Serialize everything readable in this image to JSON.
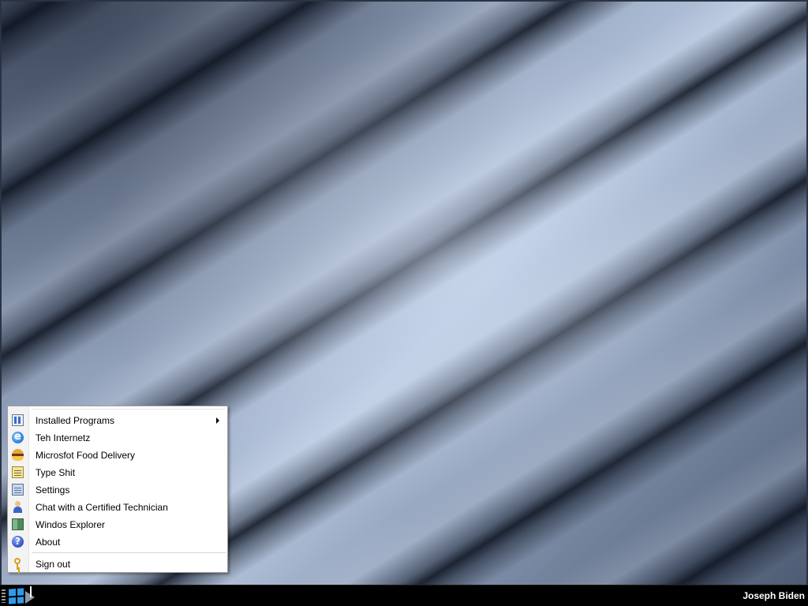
{
  "start_menu": {
    "items": [
      {
        "label": "Installed Programs",
        "icon": "installed-programs-icon",
        "has_submenu": true
      },
      {
        "label": "Teh Internetz",
        "icon": "internet-explorer-icon",
        "has_submenu": false
      },
      {
        "label": "Microsfot Food Delivery",
        "icon": "burger-icon",
        "has_submenu": false
      },
      {
        "label": "Type Shit",
        "icon": "notepad-icon",
        "has_submenu": false
      },
      {
        "label": "Settings",
        "icon": "settings-icon",
        "has_submenu": false
      },
      {
        "label": "Chat with a Certified Technician",
        "icon": "technician-icon",
        "has_submenu": false
      },
      {
        "label": "Windos Explorer",
        "icon": "explorer-icon",
        "has_submenu": false
      },
      {
        "label": "About",
        "icon": "help-icon",
        "has_submenu": false
      }
    ],
    "sign_out": {
      "label": "Sign out",
      "icon": "key-icon"
    }
  },
  "taskbar": {
    "start_icon": "windows-logo-icon",
    "username": "Joseph Biden",
    "accent_color": "#2e9bea"
  },
  "colors": {
    "taskbar_bg": "#000000",
    "menu_bg": "#ffffff",
    "menu_text": "#000000"
  }
}
